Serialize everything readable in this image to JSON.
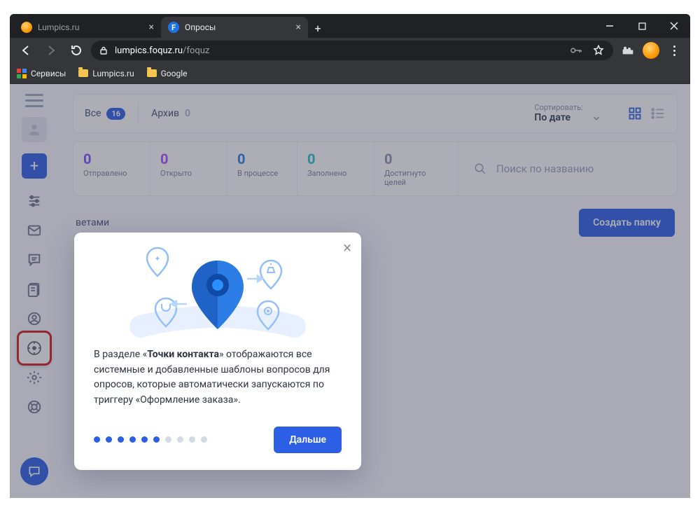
{
  "browser": {
    "tabs": [
      {
        "label": "Lumpics.ru"
      },
      {
        "label": "Опросы"
      }
    ],
    "url_host": "lumpics.foquz.ru",
    "url_path": "/foquz",
    "bookmarks": {
      "apps": "Сервисы",
      "b1": "Lumpics.ru",
      "b2": "Google"
    }
  },
  "topbar": {
    "all_label": "Все",
    "all_count": "16",
    "archive_label": "Архив",
    "archive_count": "0",
    "sort_label": "Сортировать:",
    "sort_value": "По дате"
  },
  "stats": {
    "s1": {
      "n": "0",
      "l": "Отправлено"
    },
    "s2": {
      "n": "0",
      "l": "Открыто"
    },
    "s3": {
      "n": "0",
      "l": "В процессе"
    },
    "s4": {
      "n": "0",
      "l": "Заполнено"
    },
    "s5": {
      "n": "0",
      "l": "Достигнуто целей"
    }
  },
  "search_placeholder": "Поиск по названию",
  "snippet_tail": "ветами",
  "create_folder": "Создать папку",
  "popup": {
    "text_pre": "В разделе «",
    "text_bold": "Точки контакта",
    "text_post": "» отображаются все системные и добавленные шаблоны вопросов для опросов, которые автоматически запускаются по триггеру «Оформление заказа».",
    "next": "Дальше",
    "dots_total": 10,
    "dots_active": 6
  }
}
